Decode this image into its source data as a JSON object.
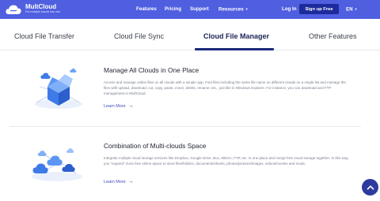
{
  "header": {
    "brand": "MultCloud",
    "tagline": "Put multiple clouds into one",
    "nav": [
      "Features",
      "Pricing",
      "Support",
      "Resources"
    ],
    "login": "Log In",
    "signup": "Sign up Free",
    "language": "EN"
  },
  "tabs": [
    {
      "label": "Cloud File Transfer",
      "active": false
    },
    {
      "label": "Cloud File Sync",
      "active": false
    },
    {
      "label": "Cloud File Manager",
      "active": true
    },
    {
      "label": "Other Features",
      "active": false
    }
  ],
  "sections": [
    {
      "title": "Manage All Clouds in One Place",
      "description": "Access and manage online files on all clouds with a simple app. Find files including the same file name on different clouds on a single list and manage the files with upload, download, cut, copy, paste, move, delete, rename, etc., just like in Windows Explorer. For instance, you can download and FTP management in MultCloud.",
      "link": "Learn More"
    },
    {
      "title": "Combination of Multi-clouds Space",
      "description": "Integrate multiple cloud storage services like Dropbox, Google Drive, Box, MEGA, FTP, etc. in one place and merge free cloud storage together. In this way, you \"expand\" more free online space to store files/folders, documents/sheets, photos/pictures/images, videos/movies and music.",
      "link": "Learn More"
    }
  ],
  "colors": {
    "header_bg": "#4f5fe0",
    "signup_bg": "#1c2a9c",
    "accent": "#1b2a7a",
    "illustration_blue": "#3f7be8"
  }
}
